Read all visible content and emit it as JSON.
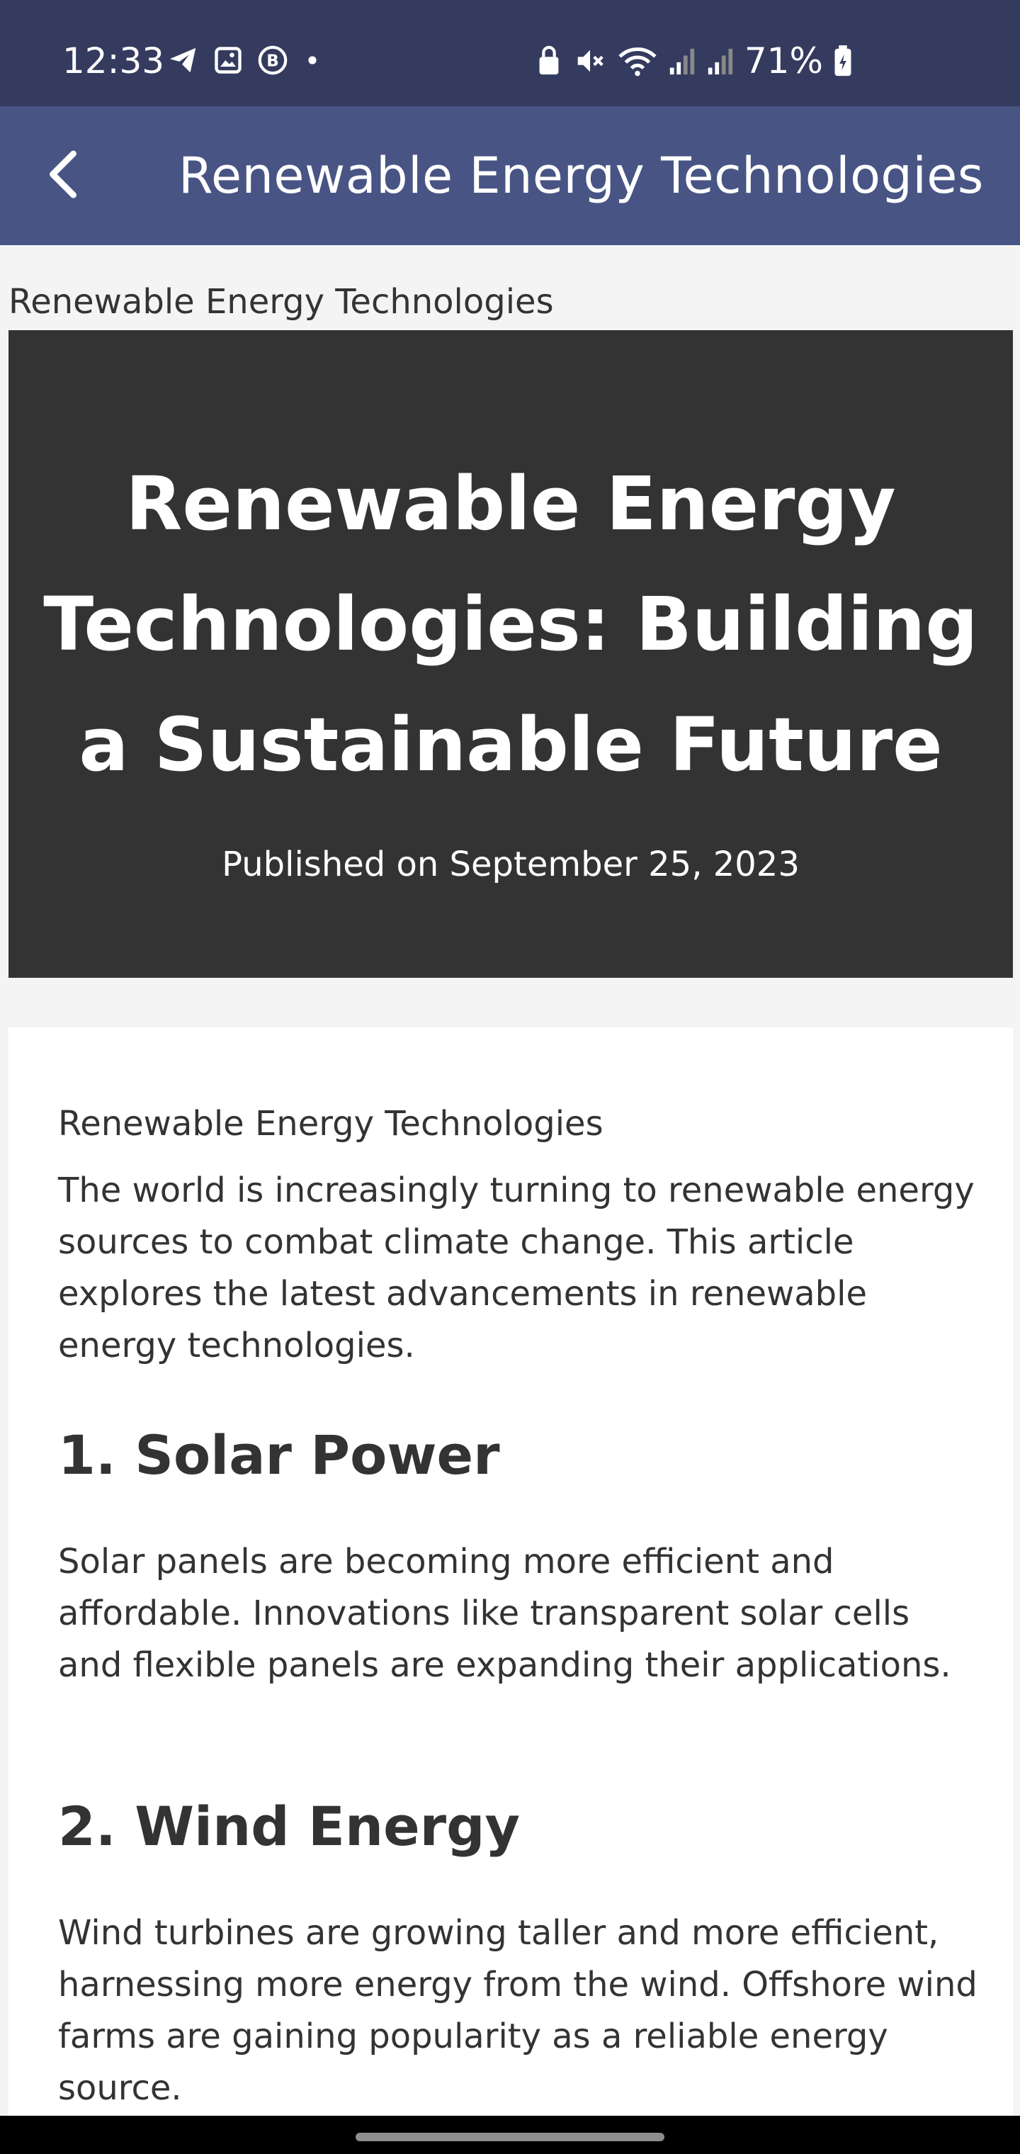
{
  "status_bar": {
    "time": "12:33",
    "battery_percent": "71%",
    "icons_left": [
      "telegram-icon",
      "gallery-icon",
      "b-icon",
      "dot-icon"
    ],
    "icons_right": [
      "lock-icon",
      "mute-icon",
      "wifi-icon",
      "signal-icon",
      "signal-icon",
      "battery-icon"
    ]
  },
  "app_bar": {
    "title": "Renewable Energy Technologies",
    "back_icon": "chevron-left-icon"
  },
  "page": {
    "breadcrumb": "Renewable Energy Technologies",
    "hero": {
      "title": "Renewable Energy Technologies: Building a Sustainable Future",
      "date": "Published on September 25, 2023"
    },
    "article": {
      "label": "Renewable Energy Technologies",
      "intro": "The world is increasingly turning to renewable energy sources to combat climate change. This article explores the latest advancements in renewable energy technologies.",
      "sections": [
        {
          "heading": "1. Solar Power",
          "body": "Solar panels are becoming more efficient and affordable. Innovations like transparent solar cells and flexible panels are expanding their applications."
        },
        {
          "heading": "2. Wind Energy",
          "body": "Wind turbines are growing taller and more efficient, harnessing more energy from the wind. Offshore wind farms are gaining popularity as a reliable energy source."
        }
      ]
    }
  },
  "colors": {
    "status_bar_bg": "#343b5f",
    "app_bar_bg": "#485484",
    "hero_bg": "#333333",
    "page_bg": "#f4f4f4",
    "text": "#333333"
  }
}
